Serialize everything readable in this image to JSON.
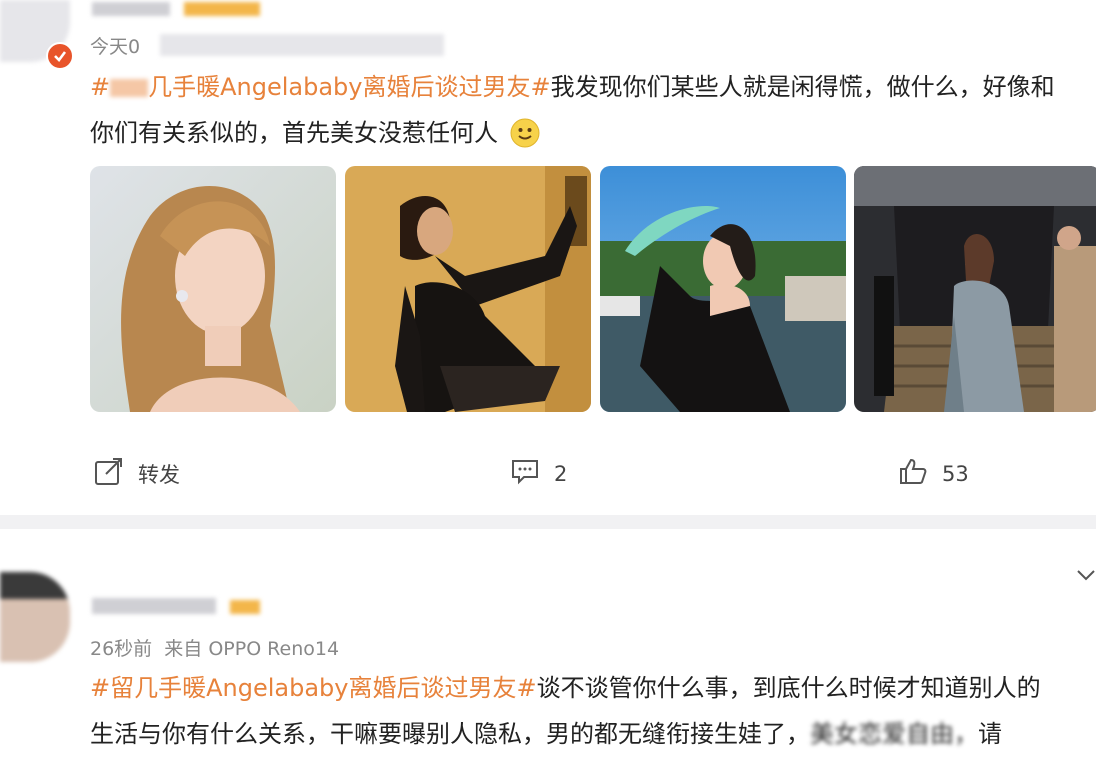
{
  "post1": {
    "time": "今天0",
    "text_line1": "#        几手暖Angelababy离婚后谈过男友#我发现你们某些人就是闲得慌，做什么，好像和",
    "topic": "#  几手暖Angelababy离婚后谈过男友#",
    "body1": "我发现你们某些人就是闲得慌，做什么，好像和",
    "body2": "你们有关系似的，首先美女没惹任何人",
    "emoji": "slightly-smiling-face",
    "actions": {
      "repost_label": "转发",
      "comment_count": "2",
      "like_count": "53"
    }
  },
  "post2": {
    "time": "26秒前",
    "source": "来自 OPPO Reno14",
    "topic": "#留几手暖Angelababy离婚后谈过男友#",
    "body1": "谈不谈管你什么事，到底什么时候才知道别人的",
    "body2": "生活与你有什么关系，干嘛要曝别人隐私，男的都无缝衔接生娃了，",
    "body2_tail": "美女恋爱自由，",
    "body2_end": "请"
  },
  "colors": {
    "topic": "#e7823b",
    "text": "#222222",
    "meta": "#888888",
    "divider": "#f1f1f3"
  }
}
